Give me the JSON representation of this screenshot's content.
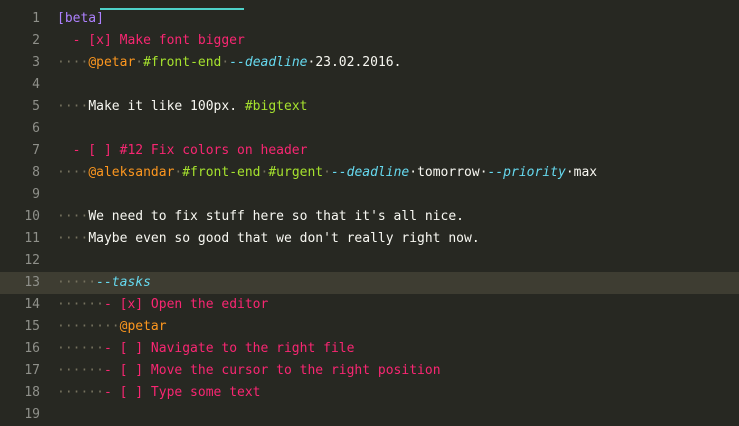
{
  "editor": {
    "accent_color": "#4ed1c8",
    "lines": [
      {
        "num": "1",
        "parts": [
          {
            "t": "[beta]",
            "c": "purple"
          }
        ]
      },
      {
        "num": "2",
        "parts": [
          {
            "t": "  - [x] Make font bigger",
            "c": "pink"
          }
        ]
      },
      {
        "num": "3",
        "parts": [
          {
            "t": "····",
            "c": "dot"
          },
          {
            "t": "@petar",
            "c": "orange"
          },
          {
            "t": "·",
            "c": "dot"
          },
          {
            "t": "#front-end",
            "c": "green"
          },
          {
            "t": "·",
            "c": "dot"
          },
          {
            "t": "--deadline",
            "c": "cyan"
          },
          {
            "t": "·23.02.2016.",
            "c": "white"
          }
        ]
      },
      {
        "num": "4",
        "parts": []
      },
      {
        "num": "5",
        "parts": [
          {
            "t": "····",
            "c": "dot"
          },
          {
            "t": "Make it like 100px. ",
            "c": "white"
          },
          {
            "t": "#bigtext",
            "c": "green"
          }
        ]
      },
      {
        "num": "6",
        "parts": []
      },
      {
        "num": "7",
        "parts": [
          {
            "t": "  - [ ] #12 Fix colors on header",
            "c": "pink"
          }
        ]
      },
      {
        "num": "8",
        "parts": [
          {
            "t": "····",
            "c": "dot"
          },
          {
            "t": "@aleksandar",
            "c": "orange"
          },
          {
            "t": "·",
            "c": "dot"
          },
          {
            "t": "#front-end",
            "c": "green"
          },
          {
            "t": "·",
            "c": "dot"
          },
          {
            "t": "#urgent",
            "c": "green"
          },
          {
            "t": "·",
            "c": "dot"
          },
          {
            "t": "--deadline",
            "c": "cyan"
          },
          {
            "t": "·tomorrow·",
            "c": "white"
          },
          {
            "t": "--priority",
            "c": "cyan"
          },
          {
            "t": "·max",
            "c": "white"
          }
        ]
      },
      {
        "num": "9",
        "parts": []
      },
      {
        "num": "10",
        "parts": [
          {
            "t": "····",
            "c": "dot"
          },
          {
            "t": "We need to fix stuff here so that it's all nice.",
            "c": "white"
          }
        ]
      },
      {
        "num": "11",
        "parts": [
          {
            "t": "····",
            "c": "dot"
          },
          {
            "t": "Maybe even so good that we don't really right now.",
            "c": "white"
          }
        ]
      },
      {
        "num": "12",
        "parts": []
      },
      {
        "num": "13",
        "current": true,
        "parts": [
          {
            "t": "·····",
            "c": "dot"
          },
          {
            "t": "--tasks",
            "c": "cyan"
          }
        ]
      },
      {
        "num": "14",
        "parts": [
          {
            "t": "······",
            "c": "dot"
          },
          {
            "t": "- [x] Open the editor",
            "c": "pink"
          }
        ]
      },
      {
        "num": "15",
        "parts": [
          {
            "t": "········",
            "c": "dot"
          },
          {
            "t": "@petar",
            "c": "orange"
          }
        ]
      },
      {
        "num": "16",
        "parts": [
          {
            "t": "······",
            "c": "dot"
          },
          {
            "t": "- [ ] Navigate to the right file",
            "c": "pink"
          }
        ]
      },
      {
        "num": "17",
        "parts": [
          {
            "t": "······",
            "c": "dot"
          },
          {
            "t": "- [ ] Move the cursor to the right position",
            "c": "pink"
          }
        ]
      },
      {
        "num": "18",
        "parts": [
          {
            "t": "······",
            "c": "dot"
          },
          {
            "t": "- [ ] Type some text",
            "c": "pink"
          }
        ]
      },
      {
        "num": "19",
        "parts": []
      }
    ]
  }
}
